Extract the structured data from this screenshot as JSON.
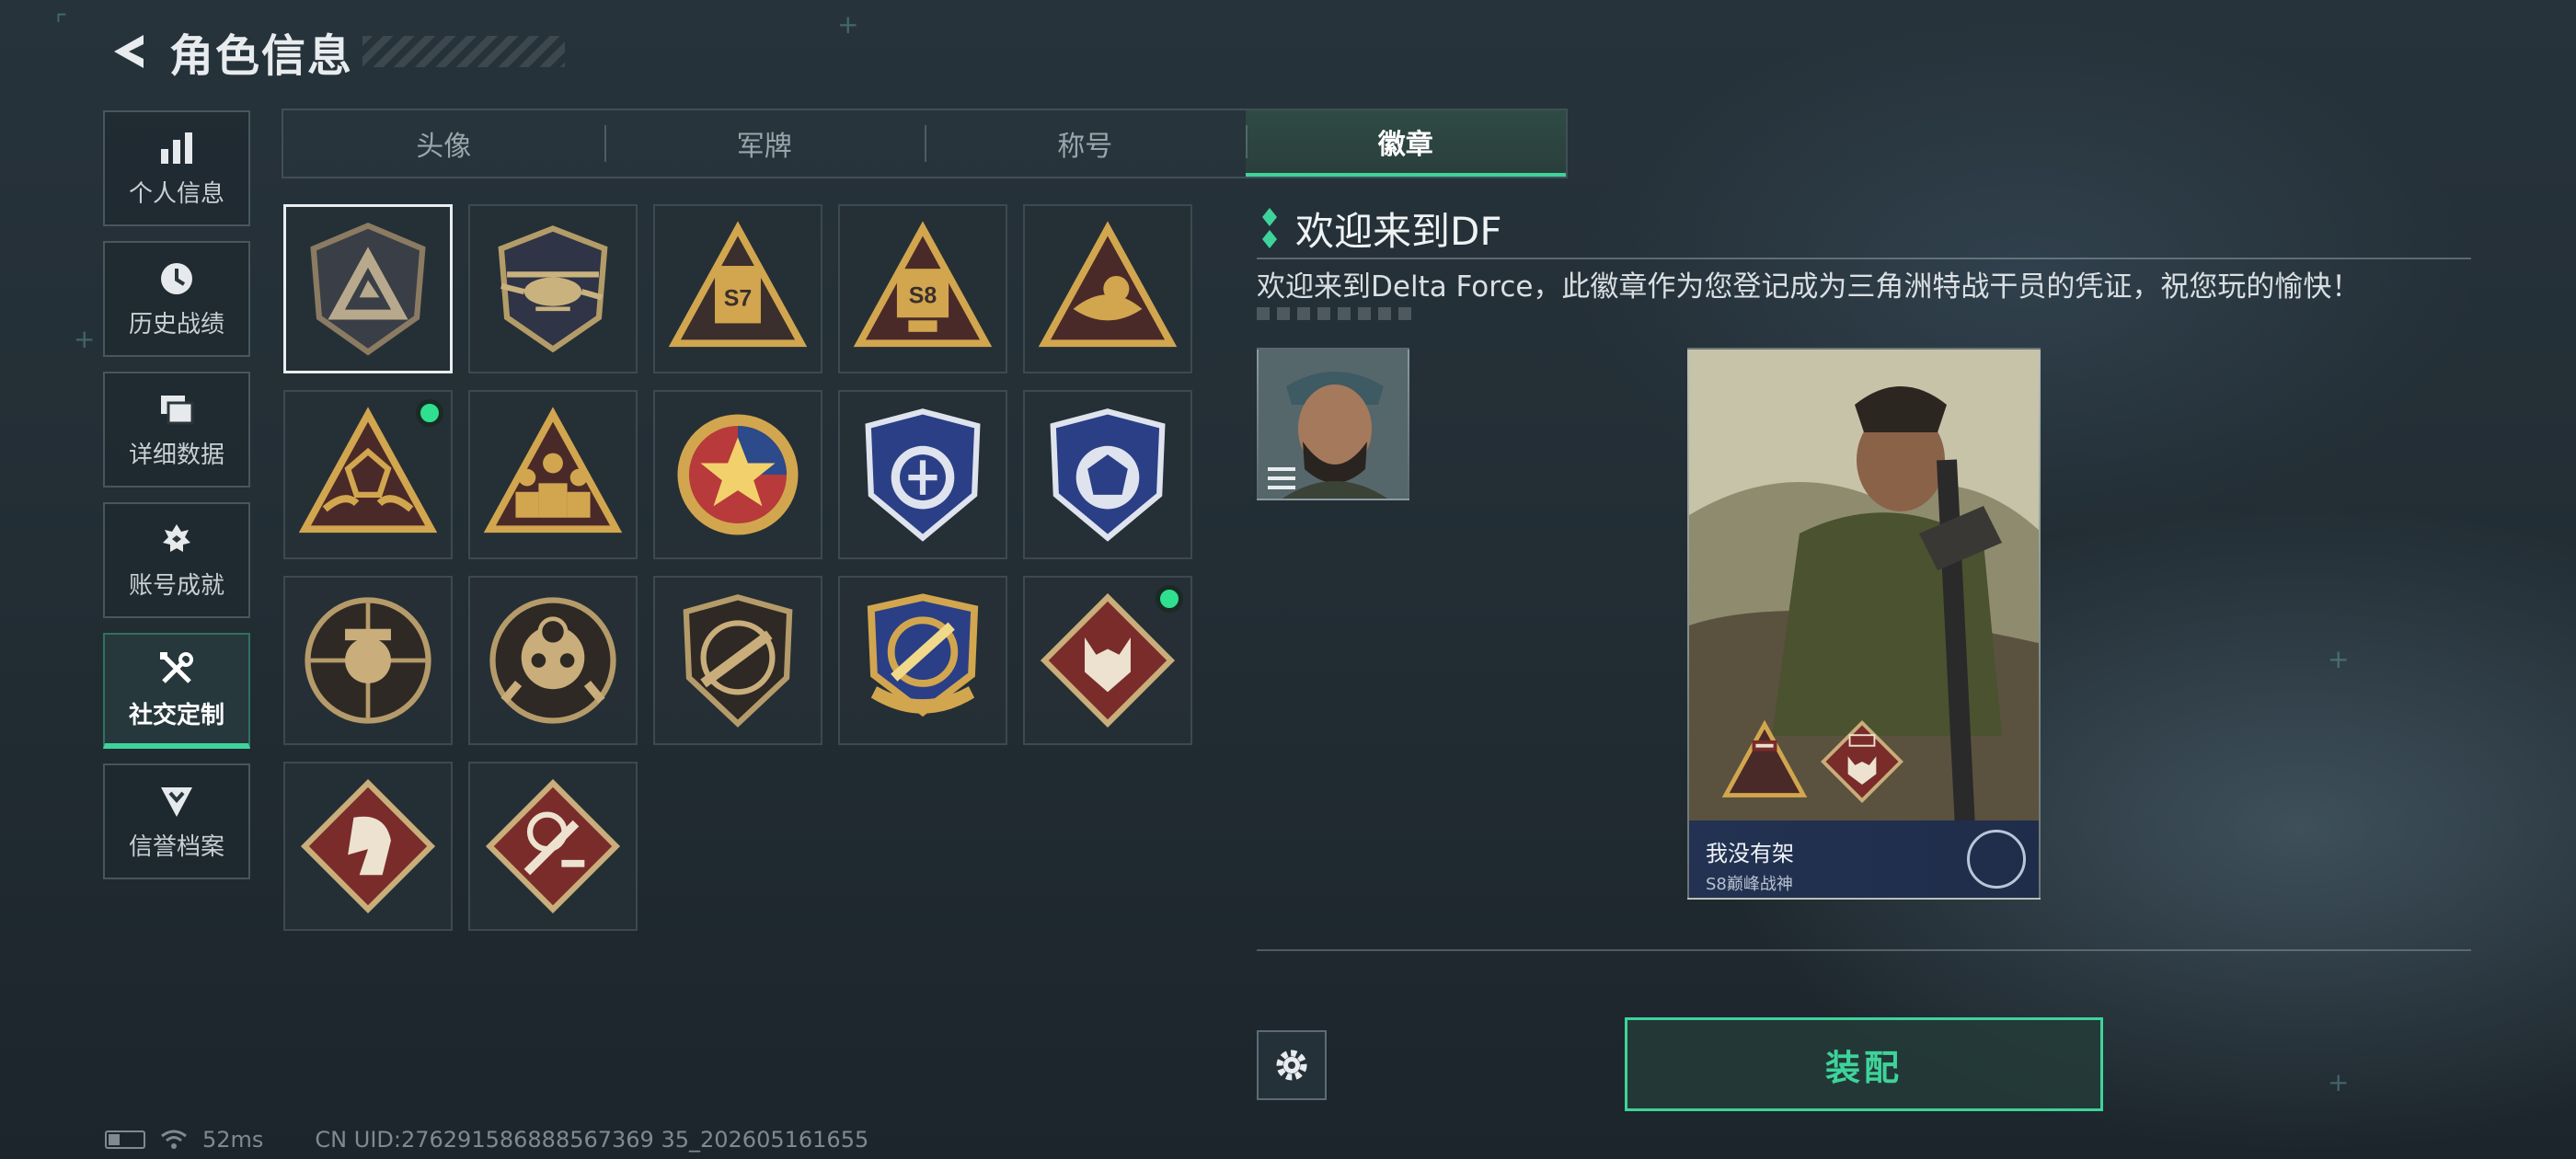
{
  "header": {
    "title": "角色信息"
  },
  "nav": [
    {
      "label": "个人信息",
      "icon": "bar-chart-icon"
    },
    {
      "label": "历史战绩",
      "icon": "clock-icon"
    },
    {
      "label": "详细数据",
      "icon": "folders-icon"
    },
    {
      "label": "账号成就",
      "icon": "achievement-icon"
    },
    {
      "label": "社交定制",
      "icon": "tools-icon",
      "active": true
    },
    {
      "label": "信誉档案",
      "icon": "reputation-icon"
    }
  ],
  "tabs": [
    {
      "label": "头像"
    },
    {
      "label": "军牌"
    },
    {
      "label": "称号"
    },
    {
      "label": "徽章",
      "active": true
    }
  ],
  "badges": [
    {
      "name": "delta-shield-badge",
      "selected": true
    },
    {
      "name": "helicopter-badge"
    },
    {
      "name": "s7-badge",
      "text": "S7"
    },
    {
      "name": "s8-badge",
      "text": "S8"
    },
    {
      "name": "bird-triangle-badge"
    },
    {
      "name": "hands-triangle-badge",
      "new": true
    },
    {
      "name": "soldiers-triangle-badge"
    },
    {
      "name": "star-roundel-badge"
    },
    {
      "name": "blue-shield-badge-1"
    },
    {
      "name": "blue-shield-badge-2"
    },
    {
      "name": "skull-sniper-badge"
    },
    {
      "name": "crosshair-skull-badge"
    },
    {
      "name": "rifle-shield-badge"
    },
    {
      "name": "knife-crest-badge"
    },
    {
      "name": "wolf-diamond-badge",
      "new": true
    },
    {
      "name": "horse-diamond-badge"
    },
    {
      "name": "tools-diamond-badge"
    }
  ],
  "detail": {
    "name": "欢迎来到DF",
    "description": "欢迎来到Delta Force，此徽章作为您登记成为三角洲特战干员的凭证，祝您玩的愉快！"
  },
  "card": {
    "player_name": "我没有架",
    "rank": "S8巅峰战神"
  },
  "buttons": {
    "equip": "装配"
  },
  "status": {
    "ping": "52ms",
    "uid": "CN UID:276291586888567369 35_202605161655"
  },
  "colors": {
    "accent": "#3ed39b",
    "new_dot": "#2ee08f"
  }
}
